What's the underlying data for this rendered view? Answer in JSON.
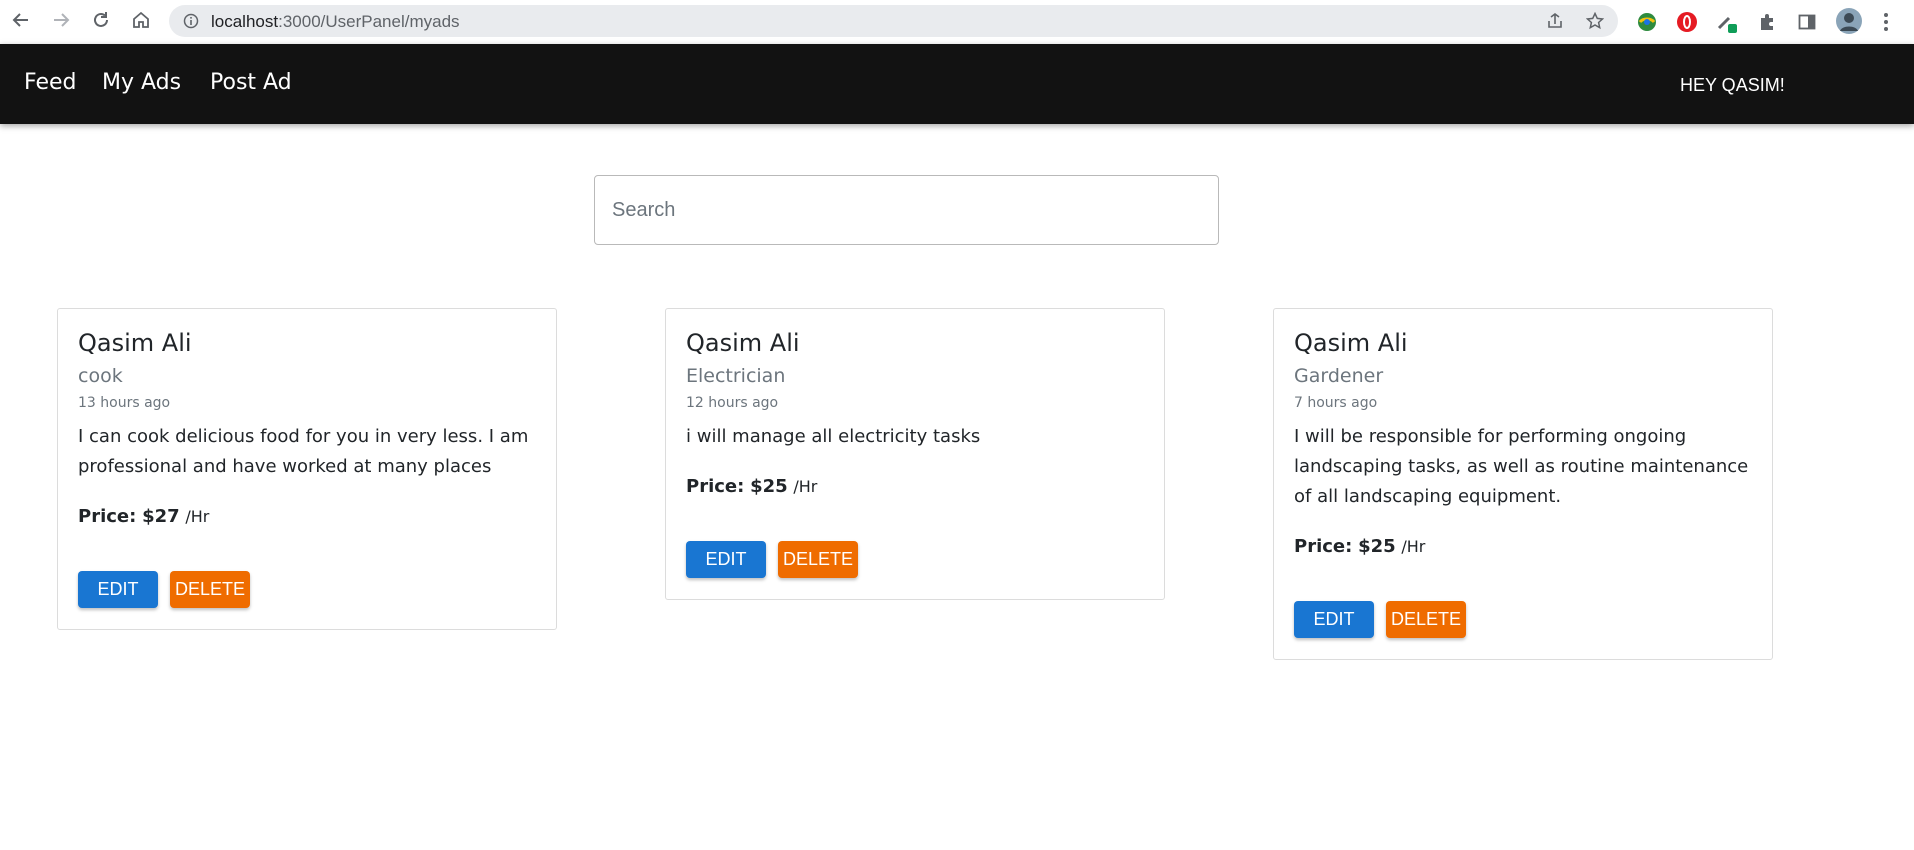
{
  "browser": {
    "url_host": "localhost",
    "url_rest": ":3000/UserPanel/myads",
    "icons": [
      "back-icon",
      "forward-icon",
      "reload-icon",
      "home-icon",
      "info-icon",
      "share-icon",
      "star-icon",
      "extension-icon",
      "puzzle-icon",
      "sidebar-icon",
      "avatar",
      "kebab-menu-icon"
    ]
  },
  "navbar": {
    "links": [
      "Feed",
      "My Ads",
      "Post Ad"
    ],
    "greeting": "HEY QASIM!"
  },
  "search": {
    "placeholder": "Search",
    "value": ""
  },
  "ads": [
    {
      "name": "Qasim Ali",
      "category": "cook",
      "time": "13 hours ago",
      "description": "I can cook delicious food for you in very less. I am professional and have worked at many places",
      "price_label": "Price:",
      "price": "$27",
      "unit": "/Hr",
      "edit_label": "EDIT",
      "delete_label": "DELETE"
    },
    {
      "name": "Qasim Ali",
      "category": "Electrician",
      "time": "12 hours ago",
      "description": "i will manage all electricity tasks",
      "price_label": "Price:",
      "price": "$25",
      "unit": "/Hr",
      "edit_label": "EDIT",
      "delete_label": "DELETE"
    },
    {
      "name": "Qasim Ali",
      "category": "Gardener",
      "time": "7 hours ago",
      "description": "I will be responsible for performing ongoing landscaping tasks, as well as routine maintenance of all landscaping equipment.",
      "price_label": "Price:",
      "price": "$25",
      "unit": "/Hr",
      "edit_label": "EDIT",
      "delete_label": "DELETE"
    }
  ],
  "colors": {
    "navbar_bg": "#121212",
    "edit_button": "#1976d2",
    "delete_button": "#ef6c00"
  }
}
